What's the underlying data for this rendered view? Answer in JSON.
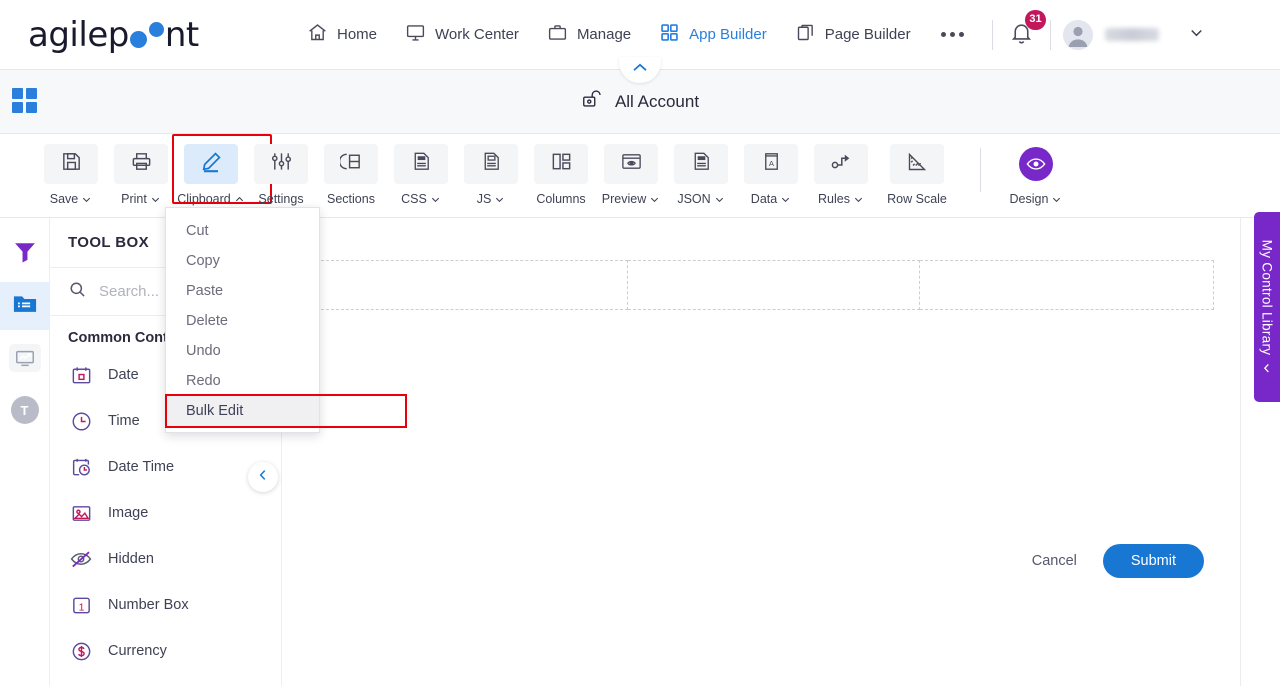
{
  "topnav": {
    "logo": {
      "part1": "a",
      "part2": "gilep",
      "part3": "nt",
      "dot_color": "#2a7fdd"
    },
    "items": [
      {
        "label": "Home",
        "icon": "home-icon",
        "active": false
      },
      {
        "label": "Work Center",
        "icon": "monitor-icon",
        "active": false
      },
      {
        "label": "Manage",
        "icon": "briefcase-icon",
        "active": false
      },
      {
        "label": "App Builder",
        "icon": "grid-icon",
        "active": true
      },
      {
        "label": "Page Builder",
        "icon": "copy-pages-icon",
        "active": false
      }
    ],
    "more_label": "•••",
    "notification_count": "31",
    "user_name": ""
  },
  "titlebar": {
    "title": "All Account",
    "lock_icon": "unlock-icon",
    "collapse_icon": "chevron-up-icon",
    "grid_toggle_icon": "grid-toggle-icon"
  },
  "toolbar": {
    "buttons": [
      {
        "label": "Save",
        "icon": "save-icon",
        "caret": "down",
        "highlighted": false,
        "selected": false
      },
      {
        "label": "Print",
        "icon": "print-icon",
        "caret": "down",
        "highlighted": false,
        "selected": false
      },
      {
        "label": "Clipboard",
        "icon": "pencil-edit-icon",
        "caret": "up",
        "highlighted": true,
        "selected": true
      },
      {
        "label": "Settings",
        "icon": "sliders-icon",
        "caret": "none",
        "highlighted": false,
        "selected": false
      },
      {
        "label": "Sections",
        "icon": "sections-icon",
        "caret": "none",
        "highlighted": false,
        "selected": false
      },
      {
        "label": "CSS",
        "icon": "css-file-icon",
        "caret": "down",
        "highlighted": false,
        "selected": false
      },
      {
        "label": "JS",
        "icon": "js-file-icon",
        "caret": "down",
        "highlighted": false,
        "selected": false
      },
      {
        "label": "Columns",
        "icon": "columns-icon",
        "caret": "none",
        "highlighted": false,
        "selected": false
      },
      {
        "label": "Preview",
        "icon": "preview-eye-icon",
        "caret": "down",
        "highlighted": false,
        "selected": false
      },
      {
        "label": "JSON",
        "icon": "json-file-icon",
        "caret": "down",
        "highlighted": false,
        "selected": false
      },
      {
        "label": "Data",
        "icon": "data-book-icon",
        "caret": "down",
        "highlighted": false,
        "selected": false
      },
      {
        "label": "Rules",
        "icon": "rules-flow-icon",
        "caret": "down",
        "highlighted": false,
        "selected": false
      },
      {
        "label": "Row Scale",
        "icon": "ruler-icon",
        "caret": "none",
        "highlighted": false,
        "selected": false
      }
    ],
    "design": {
      "label": "Design",
      "icon": "design-eye-icon",
      "caret": "down",
      "color": "#7828c8"
    },
    "selection_color": "#e8000b"
  },
  "clipboard_menu": {
    "items": [
      {
        "label": "Cut",
        "selected": false
      },
      {
        "label": "Copy",
        "selected": false
      },
      {
        "label": "Paste",
        "selected": false
      },
      {
        "label": "Delete",
        "selected": false
      },
      {
        "label": "Undo",
        "selected": false
      },
      {
        "label": "Redo",
        "selected": false
      },
      {
        "label": "Bulk Edit",
        "selected": true
      }
    ]
  },
  "rail": {
    "items": [
      {
        "name": "filter-funnel-icon",
        "active": false
      },
      {
        "name": "toolbox-folder-icon",
        "active": true
      },
      {
        "name": "analytics-chart-icon",
        "active": false
      },
      {
        "name": "text-t-icon",
        "active": false
      }
    ]
  },
  "toolbox": {
    "header": "TOOL BOX",
    "search": {
      "placeholder": "Search...",
      "value": "",
      "icon": "search-icon"
    },
    "group_label": "Common Controls",
    "controls": [
      {
        "label": "Date",
        "icon": "calendar-date-icon"
      },
      {
        "label": "Time",
        "icon": "clock-time-icon"
      },
      {
        "label": "Date Time",
        "icon": "calendar-clock-icon"
      },
      {
        "label": "Image",
        "icon": "image-picture-icon"
      },
      {
        "label": "Hidden",
        "icon": "eye-hidden-icon"
      },
      {
        "label": "Number Box",
        "icon": "number-one-icon"
      },
      {
        "label": "Currency",
        "icon": "currency-dollar-icon"
      }
    ],
    "collapse_icon": "chevron-left-icon"
  },
  "canvas": {
    "drop_zones": [
      "",
      "",
      ""
    ],
    "cancel_label": "Cancel",
    "submit_label": "Submit",
    "submit_color": "#1877d2"
  },
  "control_library": {
    "label": "My Control Library",
    "icon": "chevron-left-icon",
    "color": "#7828c8"
  }
}
